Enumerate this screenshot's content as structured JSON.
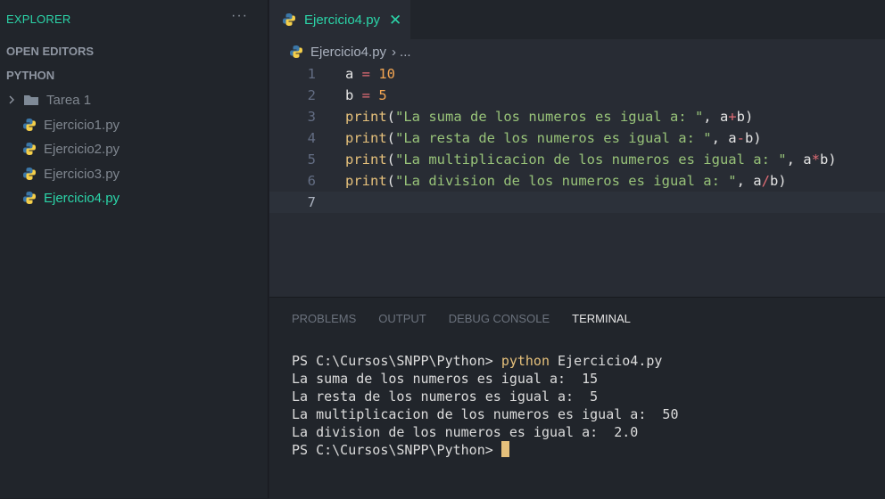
{
  "explorer": {
    "title": "EXPLORER",
    "more": "···",
    "open_editors": "OPEN EDITORS",
    "workspace": "PYTHON",
    "items": [
      {
        "label": "Tarea 1",
        "type": "folder"
      },
      {
        "label": "Ejercicio1.py",
        "type": "python"
      },
      {
        "label": "Ejercicio2.py",
        "type": "python"
      },
      {
        "label": "Ejercicio3.py",
        "type": "python"
      },
      {
        "label": "Ejercicio4.py",
        "type": "python",
        "active": true
      }
    ]
  },
  "editor": {
    "tab": {
      "label": "Ejercicio4.py",
      "close": "✕"
    },
    "breadcrumb": {
      "file": "Ejercicio4.py",
      "sep": "›",
      "more": "..."
    },
    "lines": [
      {
        "n": "1",
        "tokens": [
          [
            "var",
            "a"
          ],
          [
            "op",
            " = "
          ],
          [
            "num",
            "10"
          ]
        ]
      },
      {
        "n": "2",
        "tokens": [
          [
            "var",
            "b"
          ],
          [
            "op",
            " = "
          ],
          [
            "num",
            "5"
          ]
        ]
      },
      {
        "n": "3",
        "tokens": [
          [
            "fn",
            "print"
          ],
          [
            "punc",
            "("
          ],
          [
            "str",
            "\"La suma de los numeros es igual a: \""
          ],
          [
            "punc",
            ", a"
          ],
          [
            "op",
            "+"
          ],
          [
            "punc",
            "b)"
          ]
        ]
      },
      {
        "n": "4",
        "tokens": [
          [
            "fn",
            "print"
          ],
          [
            "punc",
            "("
          ],
          [
            "str",
            "\"La resta de los numeros es igual a: \""
          ],
          [
            "punc",
            ", a"
          ],
          [
            "op",
            "-"
          ],
          [
            "punc",
            "b)"
          ]
        ]
      },
      {
        "n": "5",
        "tokens": [
          [
            "fn",
            "print"
          ],
          [
            "punc",
            "("
          ],
          [
            "str",
            "\"La multiplicacion de los numeros es igual a: \""
          ],
          [
            "punc",
            ", a"
          ],
          [
            "op",
            "*"
          ],
          [
            "punc",
            "b)"
          ]
        ]
      },
      {
        "n": "6",
        "tokens": [
          [
            "fn",
            "print"
          ],
          [
            "punc",
            "("
          ],
          [
            "str",
            "\"La division de los numeros es igual a: \""
          ],
          [
            "punc",
            ", a"
          ],
          [
            "op",
            "/"
          ],
          [
            "punc",
            "b)"
          ]
        ]
      },
      {
        "n": "7",
        "tokens": [],
        "current": true
      }
    ]
  },
  "panel": {
    "tabs": [
      {
        "label": "PROBLEMS"
      },
      {
        "label": "OUTPUT"
      },
      {
        "label": "DEBUG CONSOLE"
      },
      {
        "label": "TERMINAL",
        "active": true
      }
    ],
    "terminal": {
      "prompt": "PS C:\\Cursos\\SNPP\\Python> ",
      "command": "python",
      "args": " Ejercicio4.py",
      "output": [
        "La suma de los numeros es igual a:  15",
        "La resta de los numeros es igual a:  5",
        "La multiplicacion de los numeros es igual a:  50",
        "La division de los numeros es igual a:  2.0"
      ]
    }
  },
  "colors": {
    "accent": "#2bd4a8",
    "sidebar_bg": "#21252b",
    "editor_bg": "#282c34",
    "cursor": "#e5c07b"
  },
  "icons": {
    "file": "python-icon",
    "folder": "folder-icon",
    "chevron": "chevron-right-icon"
  }
}
